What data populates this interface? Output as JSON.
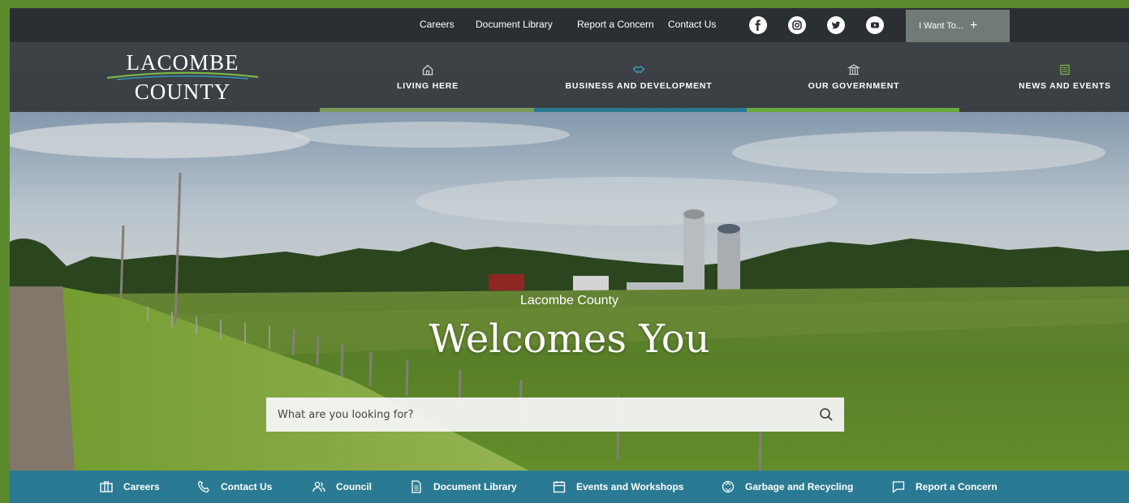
{
  "topbar": {
    "links": [
      "Careers",
      "Document Library",
      "Report a Concern",
      "Contact Us"
    ],
    "social": [
      "facebook-icon",
      "instagram-icon",
      "twitter-icon",
      "youtube-icon"
    ],
    "i_want": "I Want To...",
    "i_want_icon": "+"
  },
  "logo": {
    "line1": "LACOMBE",
    "line2": "COUNTY"
  },
  "nav": [
    {
      "label": "LIVING HERE",
      "icon": "home-icon",
      "accent": "#7a9a5a"
    },
    {
      "label": "BUSINESS AND DEVELOPMENT",
      "icon": "handshake-icon",
      "accent": "#2a7a93"
    },
    {
      "label": "OUR GOVERNMENT",
      "icon": "government-building-icon",
      "accent": "#6aa83a"
    },
    {
      "label": "NEWS AND EVENTS",
      "icon": "newspaper-icon",
      "accent": "#6aa83a"
    }
  ],
  "hero": {
    "subtitle": "Lacombe County",
    "title": "Welcomes You",
    "search_placeholder": "What are you looking for?"
  },
  "quicklinks": [
    {
      "label": "Careers",
      "icon": "briefcase-icon"
    },
    {
      "label": "Contact Us",
      "icon": "phone-icon"
    },
    {
      "label": "Council",
      "icon": "people-icon"
    },
    {
      "label": "Document Library",
      "icon": "document-icon"
    },
    {
      "label": "Events and Workshops",
      "icon": "calendar-icon"
    },
    {
      "label": "Garbage and Recycling",
      "icon": "recycle-icon"
    },
    {
      "label": "Report a Concern",
      "icon": "chat-icon"
    }
  ],
  "colors": {
    "topbar": "#2b2f33",
    "nav": "#3b4044",
    "quickbar": "#2a7a93",
    "i_want_bg": "#6f7b74",
    "page_border": "#5b8a2e"
  }
}
